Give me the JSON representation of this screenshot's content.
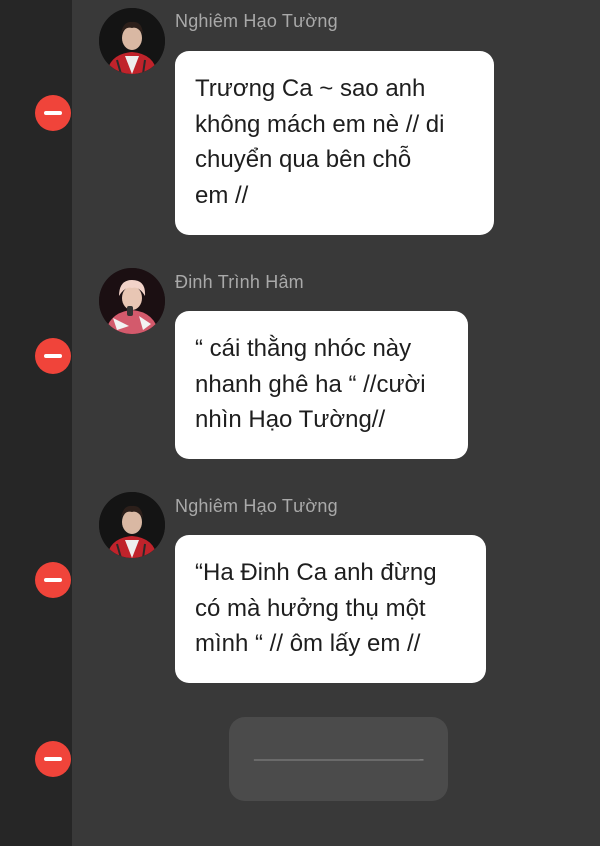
{
  "messages": [
    {
      "sender": "Nghiêm Hạo Tường",
      "avatar_icon": "avatar-red-jacket-icon",
      "lines": [
        "Trương Ca ~ sao anh",
        "không mách em nè // di",
        "chuyển qua bên chỗ",
        "em //"
      ]
    },
    {
      "sender": "Đinh Trình Hâm",
      "avatar_icon": "avatar-pink-hair-icon",
      "lines": [
        "“ cái thằng nhóc này",
        "nhanh ghê ha “ //cười",
        "nhìn Hạo Tường//"
      ]
    },
    {
      "sender": "Nghiêm Hạo Tường",
      "avatar_icon": "avatar-red-jacket-icon",
      "lines": [
        "“Ha Đinh Ca anh đừng",
        "có mà hưởng thụ một",
        "mình “ // ôm lấy em //"
      ]
    }
  ],
  "draft": {
    "text": "———————————-"
  },
  "colors": {
    "remove_button": "#f0443a",
    "left_strip": "#262626",
    "chat_background": "#393939",
    "bubble": "#ffffff",
    "sender_name": "#a9a9a9"
  }
}
